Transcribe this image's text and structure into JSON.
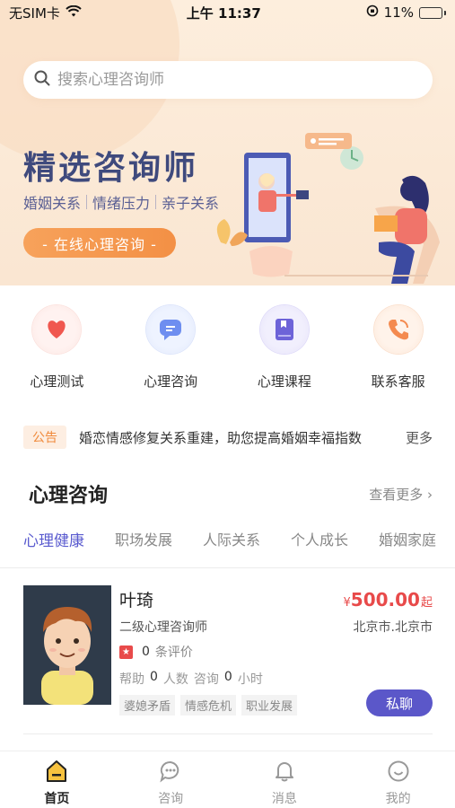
{
  "status_bar": {
    "carrier": "无SIM卡",
    "time": "上午 11:37",
    "battery": "11%"
  },
  "search": {
    "placeholder": "搜索心理咨询师"
  },
  "banner": {
    "title": "精选咨询师",
    "tags": [
      "婚姻关系",
      "情绪压力",
      "亲子关系"
    ],
    "button": "- 在线心理咨询 -"
  },
  "menu": {
    "items": [
      {
        "label": "心理测试",
        "icon": "heart-icon"
      },
      {
        "label": "心理咨询",
        "icon": "chat-bubble-icon"
      },
      {
        "label": "心理课程",
        "icon": "book-icon"
      },
      {
        "label": "联系客服",
        "icon": "phone-icon"
      }
    ]
  },
  "notice": {
    "tag": "公告",
    "text": "婚恋情感修复关系重建，助您提高婚姻幸福指数",
    "more": "更多"
  },
  "section": {
    "title": "心理咨询",
    "more": "查看更多 ›"
  },
  "tabs": [
    "心理健康",
    "职场发展",
    "人际关系",
    "个人成长",
    "婚姻家庭"
  ],
  "counselor": {
    "name": "叶琦",
    "price_currency": "¥",
    "price_amount": "500.00",
    "price_unit": "起",
    "title": "二级心理咨询师",
    "city": "北京市.北京市",
    "rating_count": "0",
    "rating_label": "条评价",
    "help_label": "帮助",
    "help_count": "0",
    "help_unit": "人数",
    "consult_label": "咨询",
    "consult_count": "0",
    "consult_unit": "小时",
    "tags": [
      "婆媳矛盾",
      "情感危机",
      "职业发展"
    ],
    "chat_button": "私聊"
  },
  "tabbar": {
    "items": [
      {
        "label": "首页",
        "icon": "home-icon",
        "active": true
      },
      {
        "label": "咨询",
        "icon": "consult-chat-icon",
        "active": false
      },
      {
        "label": "消息",
        "icon": "bell-icon",
        "active": false
      },
      {
        "label": "我的",
        "icon": "profile-smile-icon",
        "active": false
      }
    ]
  },
  "colors": {
    "accent": "#5a5bcf",
    "orange": "#f39045",
    "price_red": "#e84a4a",
    "banner_title": "#3f4a7d"
  }
}
